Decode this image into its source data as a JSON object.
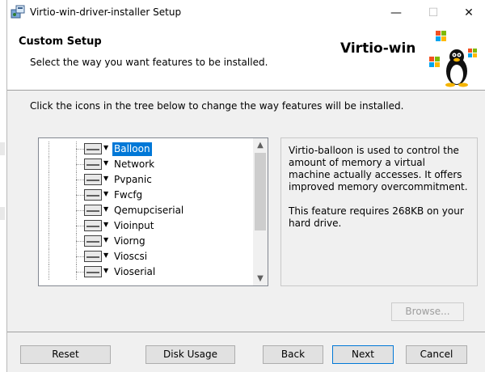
{
  "window": {
    "title": "Virtio-win-driver-installer Setup",
    "controls": {
      "minimize": "—",
      "maximize": "☐",
      "close": "✕"
    }
  },
  "banner": {
    "title": "Custom Setup",
    "subtitle": "Select the way you want features to be installed.",
    "brand": "Virtio-win"
  },
  "instructions": "Click the icons in the tree below to change the way features will be installed.",
  "tree": {
    "items": [
      {
        "label": "Balloon",
        "selected": true
      },
      {
        "label": "Network"
      },
      {
        "label": "Pvpanic"
      },
      {
        "label": "Fwcfg"
      },
      {
        "label": "Qemupciserial"
      },
      {
        "label": "Vioinput"
      },
      {
        "label": "Viorng"
      },
      {
        "label": "Vioscsi"
      },
      {
        "label": "Vioserial"
      }
    ]
  },
  "description": {
    "text": "Virtio-balloon is used to control the amount of memory a virtual machine actually accesses. It offers improved memory overcommitment.",
    "size_note": "This feature requires 268KB on your hard drive."
  },
  "buttons": {
    "browse": "Browse...",
    "reset": "Reset",
    "disk_usage": "Disk Usage",
    "back": "Back",
    "next": "Next",
    "cancel": "Cancel"
  },
  "colors": {
    "selection": "#0078d7",
    "accent_border": "#0078d7"
  }
}
